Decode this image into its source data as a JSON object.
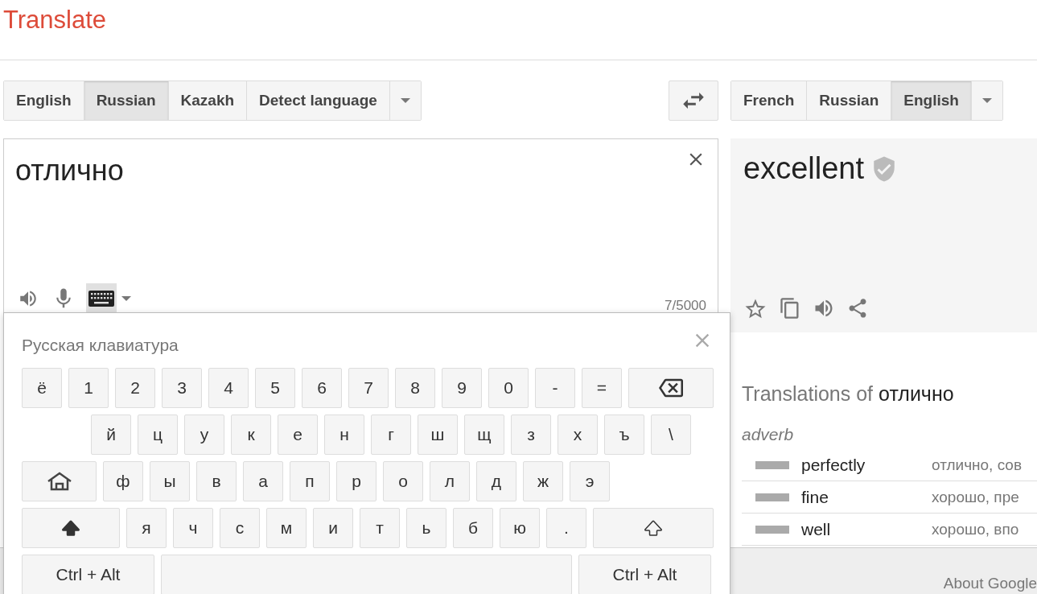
{
  "app_title": "Translate",
  "source_languages": [
    {
      "label": "English",
      "selected": false
    },
    {
      "label": "Russian",
      "selected": true
    },
    {
      "label": "Kazakh",
      "selected": false
    },
    {
      "label": "Detect language",
      "selected": false
    }
  ],
  "target_languages": [
    {
      "label": "French",
      "selected": false
    },
    {
      "label": "Russian",
      "selected": false
    },
    {
      "label": "English",
      "selected": true
    }
  ],
  "source": {
    "value": "отлично",
    "counter": "7/5000",
    "keyboard_on": true
  },
  "target": {
    "text": "excellent",
    "verified": true
  },
  "keyboard": {
    "title": "Русская клавиатура",
    "rows": [
      {
        "keys": [
          {
            "kind": "char",
            "label": "ё"
          },
          {
            "kind": "char",
            "label": "1"
          },
          {
            "kind": "char",
            "label": "2"
          },
          {
            "kind": "char",
            "label": "3"
          },
          {
            "kind": "char",
            "label": "4"
          },
          {
            "kind": "char",
            "label": "5"
          },
          {
            "kind": "char",
            "label": "6"
          },
          {
            "kind": "char",
            "label": "7"
          },
          {
            "kind": "char",
            "label": "8"
          },
          {
            "kind": "char",
            "label": "9"
          },
          {
            "kind": "char",
            "label": "0"
          },
          {
            "kind": "char",
            "label": "-"
          },
          {
            "kind": "char",
            "label": "="
          },
          {
            "kind": "backspace"
          }
        ]
      },
      {
        "keys": [
          {
            "kind": "indent"
          },
          {
            "kind": "char",
            "label": "й"
          },
          {
            "kind": "char",
            "label": "ц"
          },
          {
            "kind": "char",
            "label": "у"
          },
          {
            "kind": "char",
            "label": "к"
          },
          {
            "kind": "char",
            "label": "е"
          },
          {
            "kind": "char",
            "label": "н"
          },
          {
            "kind": "char",
            "label": "г"
          },
          {
            "kind": "char",
            "label": "ш"
          },
          {
            "kind": "char",
            "label": "щ"
          },
          {
            "kind": "char",
            "label": "з"
          },
          {
            "kind": "char",
            "label": "х"
          },
          {
            "kind": "char",
            "label": "ъ"
          },
          {
            "kind": "char",
            "label": "\\"
          }
        ]
      },
      {
        "keys": [
          {
            "kind": "layout"
          },
          {
            "kind": "char",
            "label": "ф"
          },
          {
            "kind": "char",
            "label": "ы"
          },
          {
            "kind": "char",
            "label": "в"
          },
          {
            "kind": "char",
            "label": "а"
          },
          {
            "kind": "char",
            "label": "п"
          },
          {
            "kind": "char",
            "label": "р"
          },
          {
            "kind": "char",
            "label": "о"
          },
          {
            "kind": "char",
            "label": "л"
          },
          {
            "kind": "char",
            "label": "д"
          },
          {
            "kind": "char",
            "label": "ж"
          },
          {
            "kind": "char",
            "label": "э"
          }
        ]
      },
      {
        "keys": [
          {
            "kind": "shift_left"
          },
          {
            "kind": "char",
            "label": "я"
          },
          {
            "kind": "char",
            "label": "ч"
          },
          {
            "kind": "char",
            "label": "с"
          },
          {
            "kind": "char",
            "label": "м"
          },
          {
            "kind": "char",
            "label": "и"
          },
          {
            "kind": "char",
            "label": "т"
          },
          {
            "kind": "char",
            "label": "ь"
          },
          {
            "kind": "char",
            "label": "б"
          },
          {
            "kind": "char",
            "label": "ю"
          },
          {
            "kind": "char",
            "label": "."
          },
          {
            "kind": "shift_right"
          }
        ]
      },
      {
        "keys": [
          {
            "kind": "ctrl",
            "label": "Ctrl + Alt"
          },
          {
            "kind": "space"
          },
          {
            "kind": "ctrl",
            "label": "Ctrl + Alt"
          }
        ]
      }
    ]
  },
  "translations": {
    "heading": "Translations of",
    "word": "отлично",
    "part_of_speech": "adverb",
    "rows": [
      {
        "word": "perfectly",
        "level": 1,
        "synonyms": "отлично, сов"
      },
      {
        "word": "fine",
        "level": 1,
        "synonyms": "хорошо, пре"
      },
      {
        "word": "well",
        "level": 1,
        "synonyms": "хорошо, впо"
      }
    ]
  },
  "footer": {
    "link": "About Google"
  }
}
